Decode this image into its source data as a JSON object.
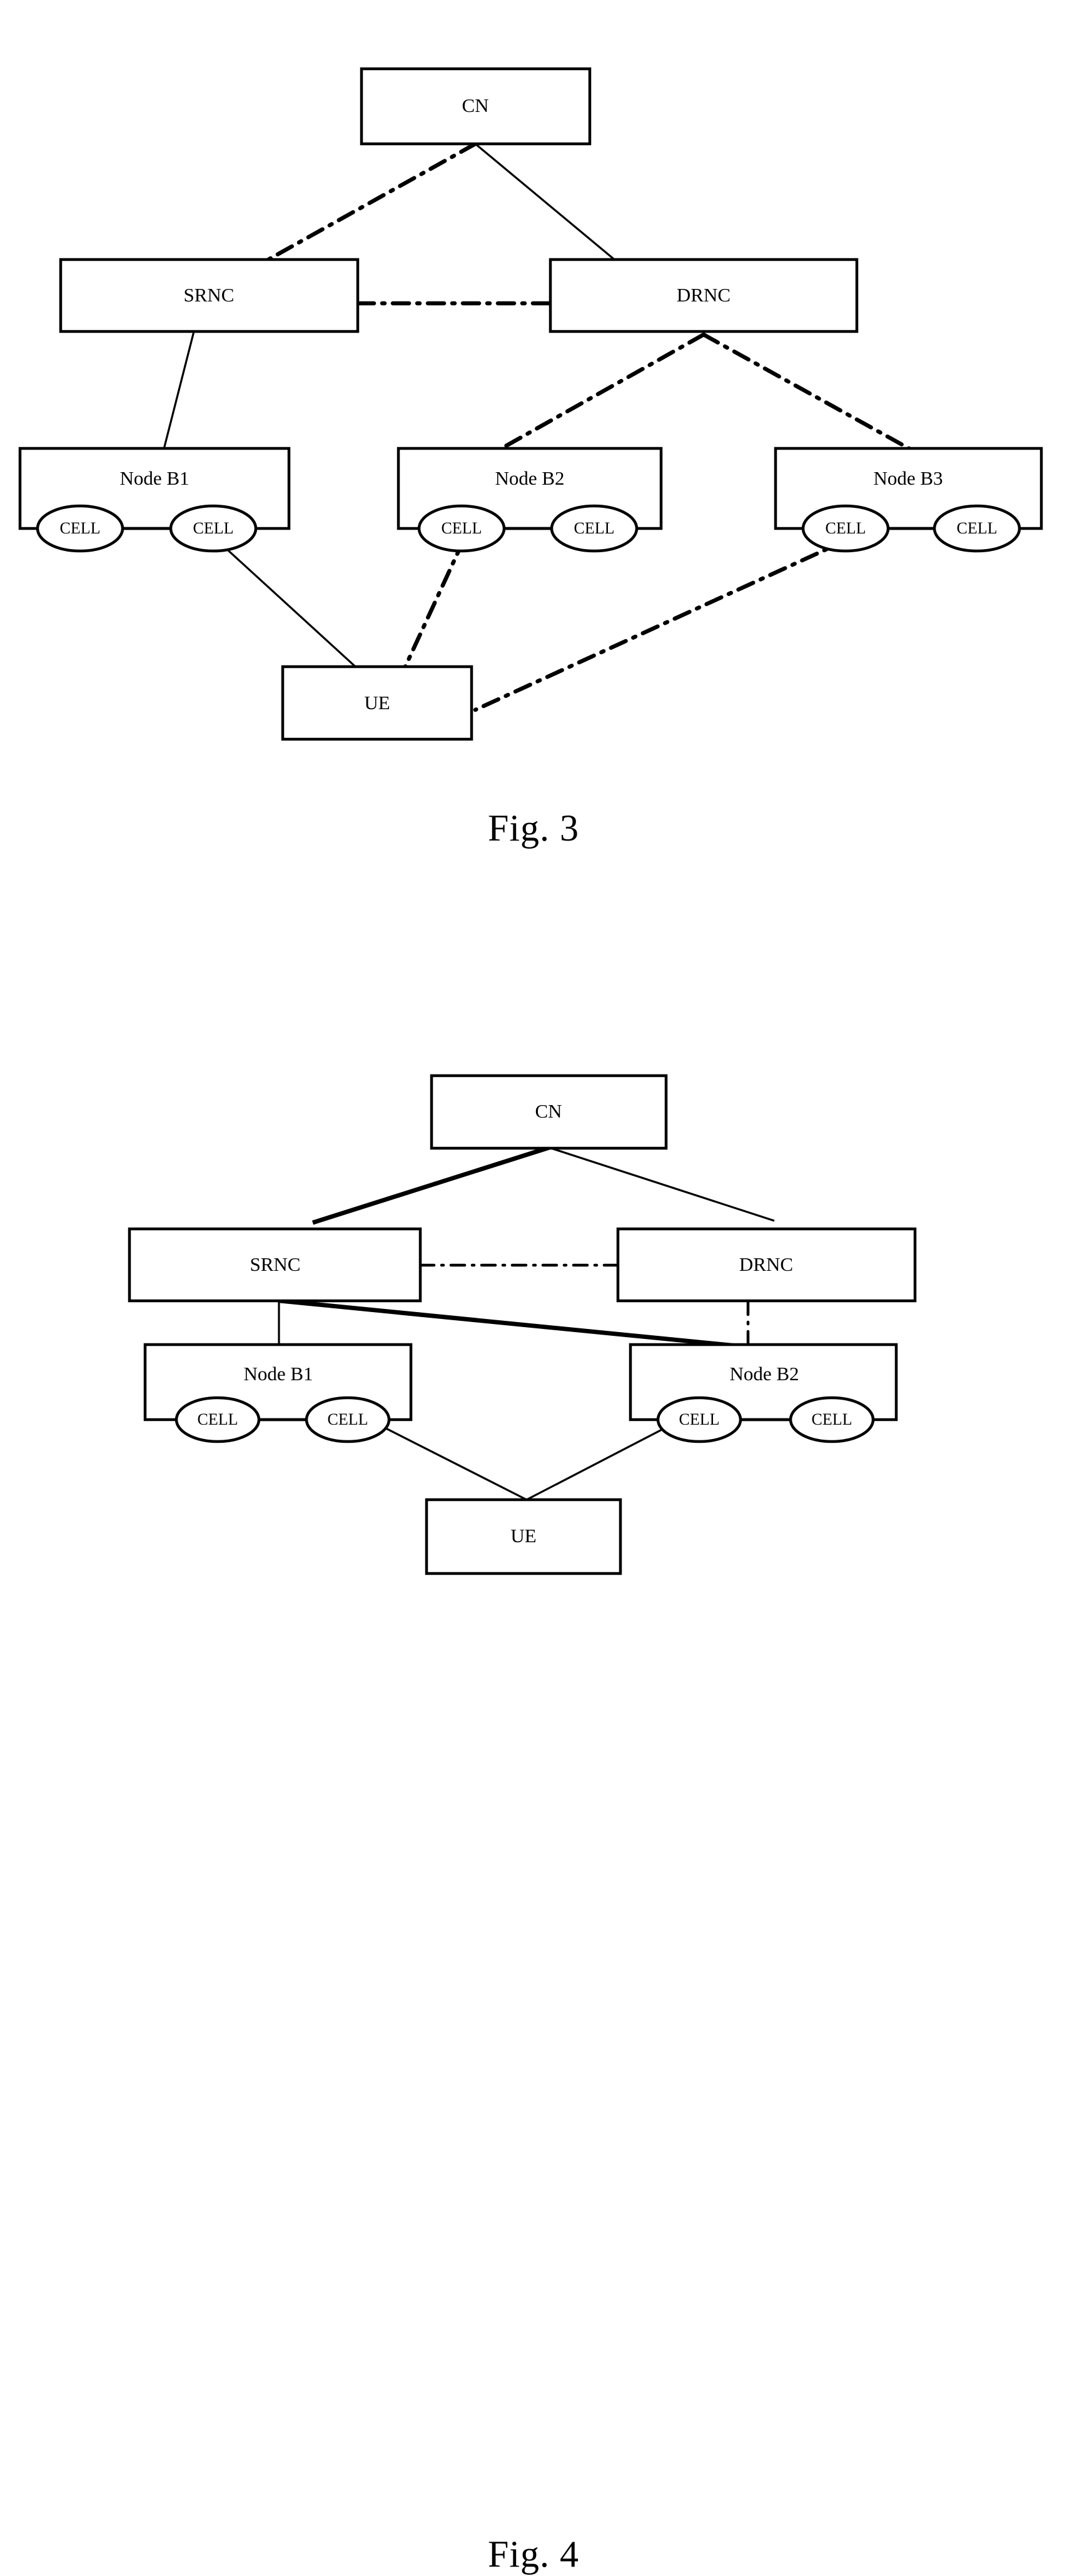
{
  "document": {
    "type": "patent-drawing-sheet",
    "background_color": "#ffffff",
    "line_color": "#000000"
  },
  "figures": [
    {
      "id": "figure-3",
      "caption": "Fig. 3",
      "nodes": {
        "cn": "CN",
        "srnc": "SRNC",
        "drnc": "DRNC",
        "node_b1": "Node B1",
        "node_b2": "Node B2",
        "node_b3": "Node B3",
        "ue": "UE"
      },
      "cells": {
        "b1_left": "CELL",
        "b1_right": "CELL",
        "b2_left": "CELL",
        "b2_right": "CELL",
        "b3_left": "CELL",
        "b3_right": "CELL"
      },
      "links": [
        {
          "from": "CN",
          "to": "SRNC",
          "style": "dash-dot"
        },
        {
          "from": "CN",
          "to": "DRNC",
          "style": "solid"
        },
        {
          "from": "SRNC",
          "to": "DRNC",
          "style": "dash-dot"
        },
        {
          "from": "SRNC",
          "to": "Node B1",
          "style": "solid"
        },
        {
          "from": "DRNC",
          "to": "Node B2",
          "style": "dash-dot"
        },
        {
          "from": "DRNC",
          "to": "Node B3",
          "style": "dash-dot"
        },
        {
          "from": "Node B1 CELL",
          "to": "UE",
          "style": "solid"
        },
        {
          "from": "Node B2 CELL",
          "to": "UE",
          "style": "dash-dot"
        },
        {
          "from": "Node B3 CELL",
          "to": "UE",
          "style": "dash-dot"
        }
      ]
    },
    {
      "id": "figure-4",
      "caption": "Fig. 4",
      "nodes": {
        "cn": "CN",
        "srnc": "SRNC",
        "drnc": "DRNC",
        "node_b1": "Node B1",
        "node_b2": "Node B2",
        "ue": "UE"
      },
      "cells": {
        "b1_left": "CELL",
        "b1_right": "CELL",
        "b2_left": "CELL",
        "b2_right": "CELL"
      },
      "links": [
        {
          "from": "CN",
          "to": "SRNC",
          "style": "bold-solid"
        },
        {
          "from": "CN",
          "to": "DRNC",
          "style": "solid"
        },
        {
          "from": "SRNC",
          "to": "DRNC",
          "style": "dash-dot"
        },
        {
          "from": "SRNC",
          "to": "Node B1",
          "style": "solid"
        },
        {
          "from": "SRNC",
          "to": "Node B2",
          "style": "bold-solid"
        },
        {
          "from": "DRNC",
          "to": "Node B2",
          "style": "dash-dot"
        },
        {
          "from": "Node B1 CELL",
          "to": "UE",
          "style": "solid"
        },
        {
          "from": "Node B2 CELL",
          "to": "UE",
          "style": "solid"
        }
      ]
    }
  ]
}
